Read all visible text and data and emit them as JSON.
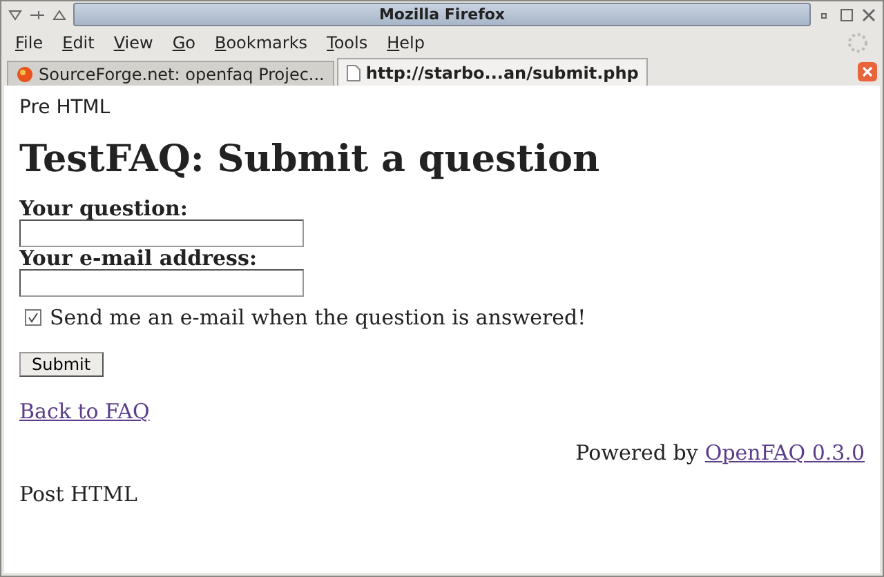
{
  "window": {
    "title": "Mozilla Firefox"
  },
  "menu": [
    "File",
    "Edit",
    "View",
    "Go",
    "Bookmarks",
    "Tools",
    "Help"
  ],
  "tabs": [
    {
      "label": "SourceForge.net: openfaq Projec...",
      "selected": false,
      "kind": "site"
    },
    {
      "label": "http://starbo...an/submit.php",
      "selected": true,
      "kind": "page"
    }
  ],
  "page": {
    "pre": "Pre HTML",
    "heading": "TestFAQ: Submit a question",
    "fields": [
      {
        "label": "Your question:"
      },
      {
        "label": "Your e-mail address:"
      }
    ],
    "notify": {
      "label": "Send me an e-mail when the question is answered!",
      "checked": true
    },
    "submit": "Submit",
    "back_link": "Back to FAQ",
    "powered_by": "Powered by",
    "powered_link": "OpenFAQ 0.3.0",
    "post": "Post HTML"
  }
}
